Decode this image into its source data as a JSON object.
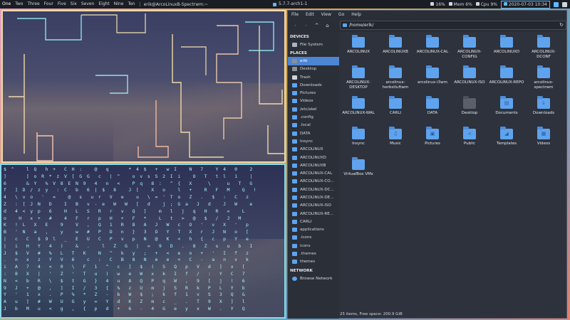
{
  "topbar": {
    "workspaces": [
      "One",
      "Two",
      "Three",
      "Four",
      "Five",
      "Six",
      "Seven",
      "Eight",
      "Nine",
      "Ten"
    ],
    "active_workspace": "One",
    "separator": "|",
    "window_title": "erik@ArcoLinuxB-Spectrwm:~",
    "kernel": "5.7.7-arch1-1",
    "volume": "16%",
    "mem": "Mem 6%",
    "cpu": "Cpu",
    "cpu_value": "9%",
    "datetime": "2020-07-03 10:34",
    "accent_color": "#5fb8ff"
  },
  "terminal_bottom": {
    "matrix_text": [
      "$ ^   l Q  h +  C H :   @  q     * 4 $  +  w I   N  7   Y 4  0   2",
      "]     ] o R * z V [ G G  c  | ^   o v s S 2 I i   O  T  t l  1   |",
      "6     & Y  % V 8 E N 9  4  n  <   P q  8 :  ^ {  X    \\    u  T  G",
      "f  ] D / z y  : C  b  6 | $  8   J [   X  o   l  +   R  F  M   Q  !",
      "4  \\ v o  '  =   @  s  u r  V  e   u  \\ = ' T o  Z  .  $  :  C  z",
      "Z  : [ J N  D   I  B  v - e  W  W  [  d   j ; G a  J  d   J  W   e",
      "d  4 < y p  6   H  L  S  R  r  v  Q  ]   m  l  j  q  H  R  =   L",
      "o   H  x +  #   4  F  r  p  H  +  F  *   L  t  >  @  $  /  J  M",
      "K  ! L  X  E   9   V  ,  Q  1  R  8  A  J  W  c  O  '  v  X  '  p",
      "B  ' N  a  ,   y   w  #  P  D  n  }  3  O  Y  T  X  r  J  N  o  [",
      "|  c  C  $ 9 l  _  E  U  C  P  v  p  N  @  K  <  h  {  c  p  Y  e",
      "|  i  H  Y  4  )   &  .   l  Z  G  |  =  9  D  .  8  Z  s  u  b  I",
      "J  $  V  #  %  L  T  K   N  ^  k  y  ;  +  <  e  o  +  '  I  f  z",
      ".  n  x  z  Y  V  6   c  :  C  B  8  N  e  e  <  C  -  a  n  v  k",
      "i  A  7  4  <  0  \\  F  1  ^  c  ]  $  (  S  Q  p  V  d  ]  x  [",
      ":  8  X  |  '  Z  '  T  u  )  w  e  W  x  k  I  f  /  :  Y  C  7",
      "N  <  b  R  \\  $  t  G  }  4  u  A  Q  P  q  W  ,  9  [  j  !  6",
      "9  J  +  @  ,  ]  I  /  3  {  %  z  U  m  j  S  R  k  P  L  Y  b",
      "Y  '  1  x  .  P  %  *  Z  -  b  W  $  ;  k  f  1  v  S  3  Q  &",
      "A  u  ]  #  W  U  G  y  =  Y  d  K  Z  m  c  _  .  T  9  X  ]  l",
      "J  b  M  u  <  g  ,  {  p  d  +  6  -  4  G  e  y  x  W  .  Y  Q"
    ]
  },
  "file_manager": {
    "menu": [
      "File",
      "Edit",
      "View",
      "Go",
      "Help"
    ],
    "nav": {
      "back_icon": "‹",
      "forward_icon": "›",
      "up_icon": "^",
      "home_icon": "⌂"
    },
    "path": "/home/erik/",
    "reload_icon": "↻",
    "sidebar": {
      "devices_header": "DEVICES",
      "devices": [
        {
          "label": "File System",
          "icon": "drive-icon"
        }
      ],
      "places_header": "PLACES",
      "places": [
        {
          "label": "erik",
          "icon": "home-icon",
          "selected": true
        },
        {
          "label": "Desktop",
          "icon": "desktop-icon"
        },
        {
          "label": "Trash",
          "icon": "trash-icon"
        },
        {
          "label": "Downloads",
          "icon": "folder-icon"
        },
        {
          "label": "Pictures",
          "icon": "folder-icon"
        },
        {
          "label": "Videos",
          "icon": "folder-icon"
        },
        {
          "label": "/etc/skel",
          "icon": "folder-icon"
        },
        {
          "label": ".config",
          "icon": "folder-icon"
        },
        {
          "label": ".local",
          "icon": "folder-icon"
        },
        {
          "label": "DATA",
          "icon": "folder-icon"
        },
        {
          "label": "Insync",
          "icon": "folder-icon"
        },
        {
          "label": "ARCOLINUX",
          "icon": "folder-icon"
        },
        {
          "label": "ARCOLINUXD",
          "icon": "folder-icon"
        },
        {
          "label": "ARCOLINUXB",
          "icon": "folder-icon"
        },
        {
          "label": "ARCOLINUX-CAL",
          "icon": "folder-icon"
        },
        {
          "label": "ARCOLINUX-CO...",
          "icon": "folder-icon"
        },
        {
          "label": "ARCOLINUX-DC...",
          "icon": "folder-icon"
        },
        {
          "label": "ARCOLINUX-DE...",
          "icon": "folder-icon"
        },
        {
          "label": "ARCOLINUX-ISO",
          "icon": "folder-icon"
        },
        {
          "label": "ARCOLINUX-RE...",
          "icon": "folder-icon"
        },
        {
          "label": "CARLI",
          "icon": "folder-icon"
        },
        {
          "label": "applications",
          "icon": "folder-icon"
        },
        {
          "label": ".icons",
          "icon": "folder-icon"
        },
        {
          "label": "icons",
          "icon": "folder-icon"
        },
        {
          "label": ".themes",
          "icon": "folder-icon"
        },
        {
          "label": "themes",
          "icon": "folder-icon"
        }
      ],
      "network_header": "NETWORK",
      "network": [
        {
          "label": "Browse Network",
          "icon": "network-icon"
        }
      ]
    },
    "items": [
      {
        "label": "ARCOLINUX",
        "icon": "folder-icon"
      },
      {
        "label": "ARCOLINUXB",
        "icon": "folder-icon"
      },
      {
        "label": "ARCOLINUX-CAL",
        "icon": "folder-icon"
      },
      {
        "label": "ARCOLINUX-CONFIG",
        "icon": "folder-icon"
      },
      {
        "label": "ARCOLINUXD",
        "icon": "folder-icon"
      },
      {
        "label": "ARCOLINUX-DCONF",
        "icon": "folder-icon"
      },
      {
        "label": "ARCOLINUX-DESKTOP",
        "icon": "folder-icon"
      },
      {
        "label": "arcolinux-herbstluftwm",
        "icon": "folder-icon"
      },
      {
        "label": "arcolinux-i3wm",
        "icon": "folder-icon"
      },
      {
        "label": "ARCOLINUX-ISO",
        "icon": "folder-icon"
      },
      {
        "label": "ARCOLINUX-REPO",
        "icon": "folder-icon"
      },
      {
        "label": "arcolinux-spectrwm",
        "icon": "folder-icon"
      },
      {
        "label": "ARCOLINUX-WAL",
        "icon": "folder-icon"
      },
      {
        "label": "CARLI",
        "icon": "folder-icon"
      },
      {
        "label": "DATA",
        "icon": "folder-icon"
      },
      {
        "label": "Desktop",
        "icon": "desktop-folder-icon",
        "dark": true
      },
      {
        "label": "Documents",
        "icon": "documents-folder-icon",
        "glyph": "▤"
      },
      {
        "label": "Downloads",
        "icon": "downloads-folder-icon",
        "glyph": "↓"
      },
      {
        "label": "Insync",
        "icon": "folder-icon"
      },
      {
        "label": "Music",
        "icon": "music-folder-icon",
        "glyph": "♫"
      },
      {
        "label": "Pictures",
        "icon": "pictures-folder-icon",
        "glyph": "▣"
      },
      {
        "label": "Public",
        "icon": "public-folder-icon",
        "glyph": "<"
      },
      {
        "label": "Templates",
        "icon": "templates-folder-icon",
        "glyph": "◢"
      },
      {
        "label": "Videos",
        "icon": "videos-folder-icon",
        "glyph": "▦"
      },
      {
        "label": "VirtualBox VMs",
        "icon": "folder-icon"
      }
    ],
    "status": "25 items, Free space: 200.9 GiB"
  }
}
